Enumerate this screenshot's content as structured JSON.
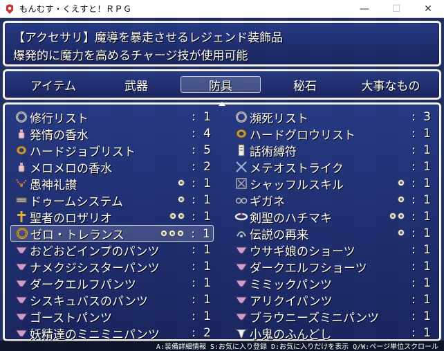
{
  "window": {
    "title": "もんむす・くえすと！ＲＰＧ",
    "minimize": "—",
    "maximize": "☐",
    "close": "✕"
  },
  "help": {
    "line1": "【アクセサリ】魔導を暴走させるレジェンド装飾品",
    "line2": "爆発的に魔力を高めるチャージ技が使用可能"
  },
  "categories": [
    "アイテム",
    "武器",
    "防具",
    "秘石",
    "大事なもの"
  ],
  "selected_category": "防具",
  "items_left": [
    {
      "name": "修行リスト",
      "count": "1",
      "dots": 0,
      "icon": "ring-icon"
    },
    {
      "name": "発情の香水",
      "count": "4",
      "dots": 0,
      "icon": "perfume-icon"
    },
    {
      "name": "ハードジョブリスト",
      "count": "5",
      "dots": 0,
      "icon": "bracelet-icon"
    },
    {
      "name": "メロメロの香水",
      "count": "2",
      "dots": 0,
      "icon": "perfume-icon"
    },
    {
      "name": "愚神礼讃",
      "count": "1",
      "dots": 1,
      "icon": "necklace-icon"
    },
    {
      "name": "ドゥームシステム",
      "count": "1",
      "dots": 1,
      "icon": "device-icon"
    },
    {
      "name": "聖者のロザリオ",
      "count": "1",
      "dots": 2,
      "icon": "cross-icon"
    },
    {
      "name": "ゼロ・トレランス",
      "count": "1",
      "dots": 3,
      "icon": "gold-ring-icon"
    },
    {
      "name": "おどおどインプのパンツ",
      "count": "1",
      "dots": 0,
      "icon": "panties-icon"
    },
    {
      "name": "ナメクジシスターパンツ",
      "count": "1",
      "dots": 0,
      "icon": "panties-icon"
    },
    {
      "name": "ダークエルフパンツ",
      "count": "1",
      "dots": 0,
      "icon": "panties-icon"
    },
    {
      "name": "シスキュバスのパンツ",
      "count": "1",
      "dots": 0,
      "icon": "panties-icon"
    },
    {
      "name": "ゴーストパンツ",
      "count": "1",
      "dots": 0,
      "icon": "panties-icon"
    },
    {
      "name": "妖精達のミニミニパンツ",
      "count": "2",
      "dots": 0,
      "icon": "panties-icon"
    }
  ],
  "items_right": [
    {
      "name": "瀕死リスト",
      "count": "3",
      "dots": 0,
      "icon": "ring-icon"
    },
    {
      "name": "ハードグロウリスト",
      "count": "1",
      "dots": 0,
      "icon": "bracelet-icon"
    },
    {
      "name": "話術縛符",
      "count": "1",
      "dots": 0,
      "icon": "talisman-icon"
    },
    {
      "name": "メテオストライク",
      "count": "1",
      "dots": 0,
      "icon": "crossed-swords-icon"
    },
    {
      "name": "シャッフルスキル",
      "count": "1",
      "dots": 1,
      "icon": "shuffle-icon"
    },
    {
      "name": "ギガネ",
      "count": "1",
      "dots": 1,
      "icon": "glasses-icon"
    },
    {
      "name": "剣聖のハチマキ",
      "count": "1",
      "dots": 2,
      "icon": "headband-icon"
    },
    {
      "name": "伝説の再来",
      "count": "1",
      "dots": 1,
      "icon": "legend-icon"
    },
    {
      "name": "ウサギ娘のショーツ",
      "count": "1",
      "dots": 0,
      "icon": "panties-icon"
    },
    {
      "name": "ダークエルフショーツ",
      "count": "1",
      "dots": 0,
      "icon": "panties-icon"
    },
    {
      "name": "ミミックパンツ",
      "count": "1",
      "dots": 0,
      "icon": "panties-icon"
    },
    {
      "name": "アリクイパンツ",
      "count": "1",
      "dots": 0,
      "icon": "panties-icon"
    },
    {
      "name": "ブラウニーズミニパンツ",
      "count": "1",
      "dots": 0,
      "icon": "panties-icon"
    },
    {
      "name": "小鬼のふんどし",
      "count": "1",
      "dots": 0,
      "icon": "loincloth-icon"
    }
  ],
  "selected_item": "ゼロ・トレランス",
  "status_bar": "A:装備詳細情報  S:お気に入り登録  D:お気に入りだけを表示  Q/W:ページ単位スクロール",
  "colors": {
    "window_bg": "#1f2f80",
    "window_border": "#f2f2f2",
    "text": "#ffffff"
  }
}
